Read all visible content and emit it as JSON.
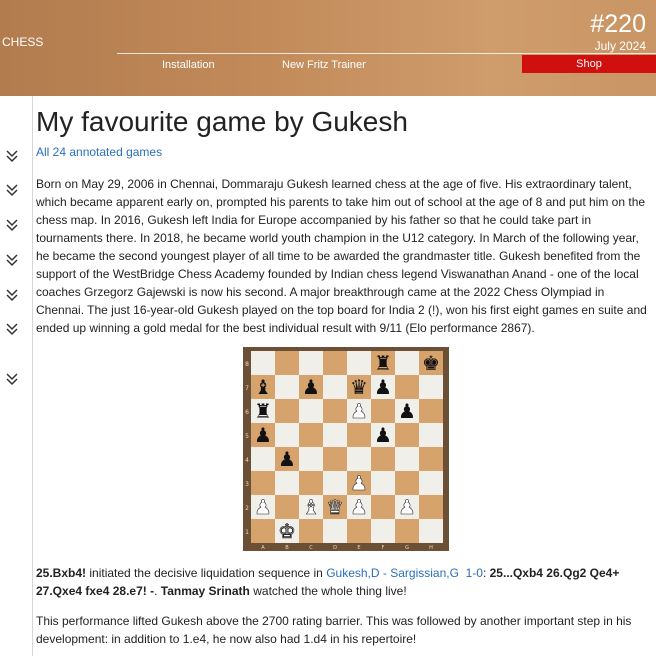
{
  "header": {
    "brand": "CHESS",
    "issue": "#220",
    "date": "July 2024",
    "nav": {
      "installation": "Installation",
      "trainer": "New Fritz Trainer",
      "shop": "Shop"
    }
  },
  "sidebar": {
    "count": 7,
    "icon": "double-chevron-down-icon"
  },
  "article": {
    "title": "My favourite game by Gukesh",
    "annotated_link": "All 24 annotated games",
    "intro": "Born on May 29, 2006 in Chennai, Dommaraju Gukesh learned chess at the age of five. His extraordinary talent, which became apparent early on, prompted his parents to take him out of school at the age of 8 and put him on the chess map. In 2016, Gukesh left India for Europe accompanied by his father so that he could take part in tournaments there. In 2018, he became world youth champion in the U12 category. In March of the following year, he became the second youngest player of all time to be awarded the grandmaster title. Gukesh benefited from the support of the WestBridge Chess Academy founded by Indian chess legend Viswanathan Anand - one of the local coaches Grzegorz Gajewski is now his second. A major breakthrough came at the 2022 Chess Olympiad in Chennai. The just 16-year-old Gukesh played on the top board for India 2 (!), won his first eight games en suite and ended up winning a gold medal for the best individual result with 9/11 (Elo performance 2867).",
    "moves": {
      "m1": "25.Bxb4!",
      "t1": " initiated the decisive liquidation sequence in ",
      "game": "Gukesh,D - Sargissian,G",
      "result": "1-0",
      "t2": ": ",
      "m2": "25...Qxb4 26.Qg2 Qe4+ 27.Qxe4 fxe4 28.e7! -",
      "t3": ". ",
      "author": "Tanmay Srinath",
      "t4": " watched the whole thing live!"
    },
    "outro": "This performance lifted Gukesh above the 2700 rating barrier. This was followed by another important step in his development: in addition to 1.e4, he now also had 1.d4 in his repertoire!"
  },
  "board": {
    "files": [
      "A",
      "B",
      "C",
      "D",
      "E",
      "F",
      "G",
      "H"
    ],
    "ranks": [
      "8",
      "7",
      "6",
      "5",
      "4",
      "3",
      "2",
      "1"
    ],
    "light": "#f0efe9",
    "dark": "#d6a36c",
    "pieces": [
      {
        "sq": "f8",
        "p": "r",
        "c": "b"
      },
      {
        "sq": "h8",
        "p": "k",
        "c": "b"
      },
      {
        "sq": "a7",
        "p": "b",
        "c": "b"
      },
      {
        "sq": "c7",
        "p": "p",
        "c": "b"
      },
      {
        "sq": "e7",
        "p": "q",
        "c": "b"
      },
      {
        "sq": "f7",
        "p": "p",
        "c": "b"
      },
      {
        "sq": "a6",
        "p": "r",
        "c": "b"
      },
      {
        "sq": "e6",
        "p": "p",
        "c": "w"
      },
      {
        "sq": "g6",
        "p": "p",
        "c": "b"
      },
      {
        "sq": "a5",
        "p": "p",
        "c": "b"
      },
      {
        "sq": "f5",
        "p": "p",
        "c": "b"
      },
      {
        "sq": "b4",
        "p": "p",
        "c": "b"
      },
      {
        "sq": "e3",
        "p": "p",
        "c": "w"
      },
      {
        "sq": "a2",
        "p": "p",
        "c": "w"
      },
      {
        "sq": "c2",
        "p": "b",
        "c": "w"
      },
      {
        "sq": "d2",
        "p": "q",
        "c": "w"
      },
      {
        "sq": "e2",
        "p": "p",
        "c": "w"
      },
      {
        "sq": "g2",
        "p": "p",
        "c": "w"
      },
      {
        "sq": "b1",
        "p": "k",
        "c": "w"
      }
    ]
  }
}
